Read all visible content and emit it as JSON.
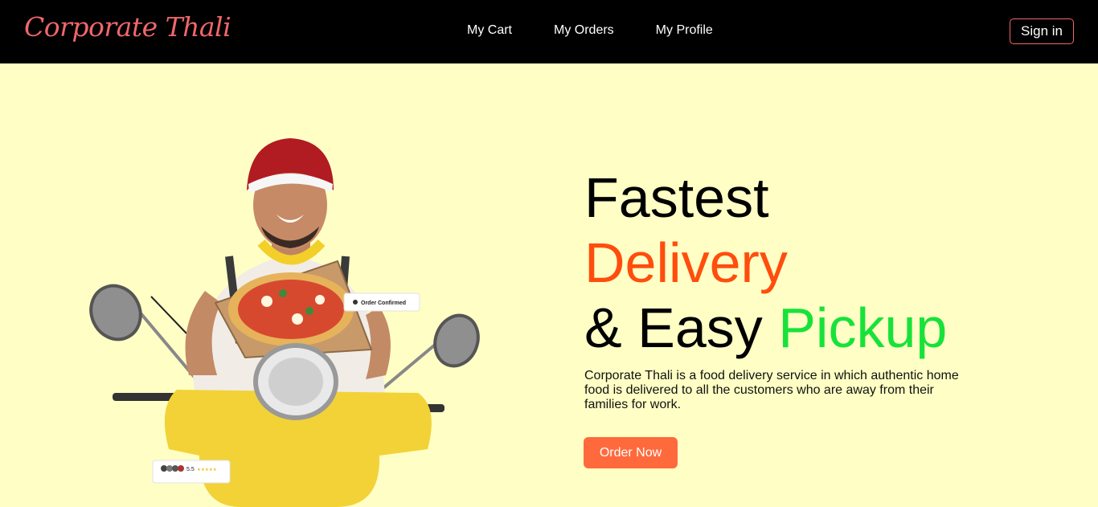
{
  "brand": {
    "name": "Corporate Thali"
  },
  "nav": {
    "items": [
      {
        "label": "My Cart"
      },
      {
        "label": "My Orders"
      },
      {
        "label": "My Profile"
      }
    ],
    "signin_label": "Sign in"
  },
  "hero": {
    "line1": "Fastest",
    "line2": "Delivery",
    "line3_a": "& Easy ",
    "line3_b": "Pickup",
    "description": "Corporate Thali is a food delivery service in which authentic home food is delivered to all the customers who are away from their families for work.",
    "cta_label": "Order Now",
    "badge_confirmed": "Order Confirmed",
    "rating_value": "5.5"
  },
  "colors": {
    "nav_bg": "#000000",
    "brand": "#f0676a",
    "hero_bg": "#ffffc5",
    "accent_orange": "#ff4d0d",
    "accent_green": "#18e23a",
    "cta": "#ff6a3d"
  }
}
